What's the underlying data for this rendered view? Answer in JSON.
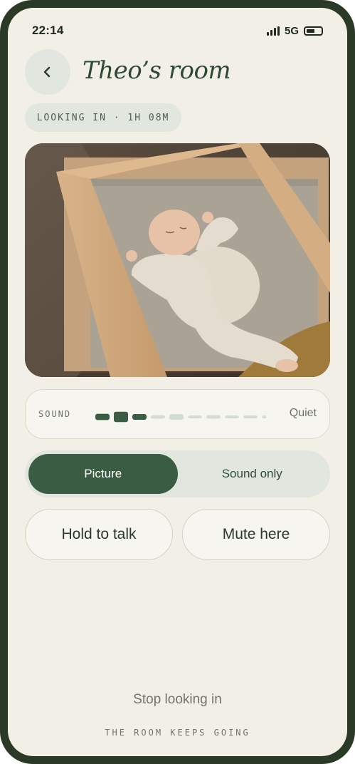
{
  "status_bar": {
    "time": "22:14",
    "network": "5G",
    "icons": [
      "signal-icon",
      "battery-icon"
    ]
  },
  "header": {
    "title": "Theo’s room",
    "back_icon": "chevron-left-icon"
  },
  "session": {
    "label": "LOOKING IN · 1H 08M"
  },
  "camera": {
    "description": "Sleeping baby in a wooden crib"
  },
  "sound": {
    "label": "SOUND",
    "status": "Quiet",
    "levels": [
      0.55,
      0.9,
      0.5,
      0.3,
      0.5,
      0.25,
      0.3,
      0.25,
      0.25,
      0.2
    ],
    "active_count": 3
  },
  "mode_toggle": {
    "options": [
      "Picture",
      "Sound only"
    ],
    "selected": "Picture"
  },
  "actions": {
    "talk": "Hold to talk",
    "mute": "Mute here"
  },
  "footer": {
    "stop": "Stop looking in",
    "caption": "THE ROOM KEEPS GOING"
  },
  "colors": {
    "accent": "#3a5c43",
    "background": "#f2efe7",
    "tint": "#e1e7df",
    "meter_inactive": "#d3ddd2"
  }
}
